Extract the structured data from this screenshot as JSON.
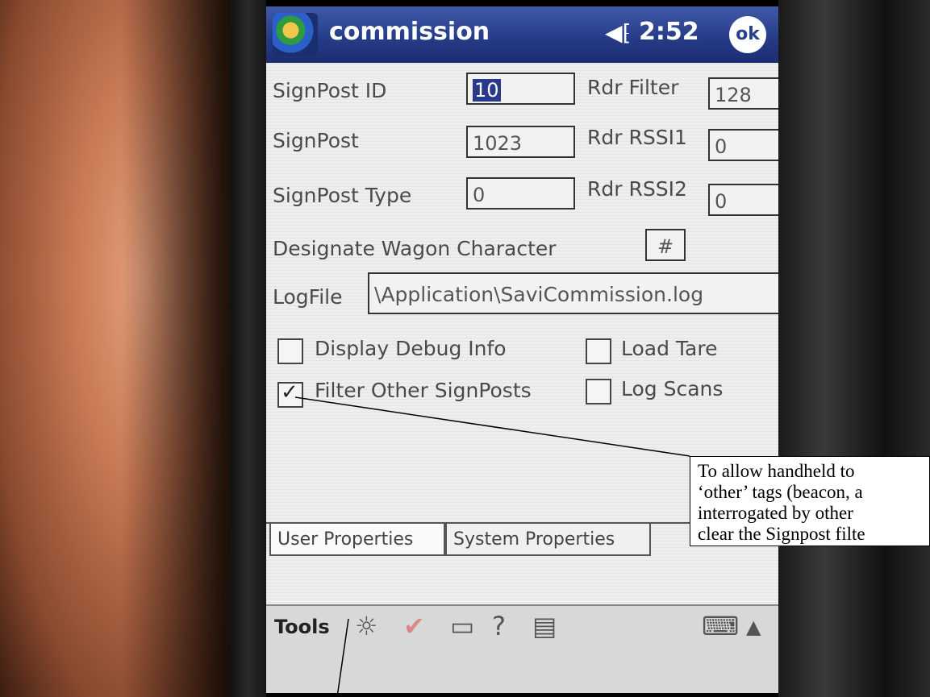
{
  "titlebar": {
    "app_title": "commission",
    "clock": "2:52",
    "ok_label": "ok",
    "speaker_icon": "speaker-icon"
  },
  "form": {
    "signpost_id_label": "SignPost ID",
    "signpost_id_value": "10",
    "rdr_filter_label": "Rdr Filter",
    "rdr_filter_value": "128",
    "signpost_label": "SignPost",
    "signpost_value": "1023",
    "rdr_rssi1_label": "Rdr RSSI1",
    "rdr_rssi1_value": "0",
    "signpost_type_label": "SignPost Type",
    "signpost_type_value": "0",
    "rdr_rssi2_label": "Rdr RSSI2",
    "rdr_rssi2_value": "0",
    "wagon_char_label": "Designate Wagon Character",
    "wagon_char_value": "#",
    "logfile_label": "LogFile",
    "logfile_value": "\\Application\\SaviCommission.log"
  },
  "checkboxes": {
    "display_debug": {
      "label": "Display Debug Info",
      "checked": false
    },
    "load_tare": {
      "label": "Load Tare",
      "checked": false
    },
    "filter_other": {
      "label": "Filter Other SignPosts",
      "checked": true
    },
    "log_scans": {
      "label": "Log Scans",
      "checked": false
    }
  },
  "tabs": [
    {
      "label": "User Properties",
      "active": true
    },
    {
      "label": "System Properties",
      "active": false
    }
  ],
  "toolbar": {
    "tools_label": "Tools",
    "icons": [
      "brightness-icon",
      "check-icon",
      "window-icon",
      "help-icon",
      "calculator-icon",
      "keyboard-icon",
      "arrow-up-icon"
    ]
  },
  "callout": {
    "lines": [
      "To allow handheld to",
      "‘other’ tags (beacon, a",
      "interrogated by other",
      "clear the Signpost filte"
    ]
  }
}
